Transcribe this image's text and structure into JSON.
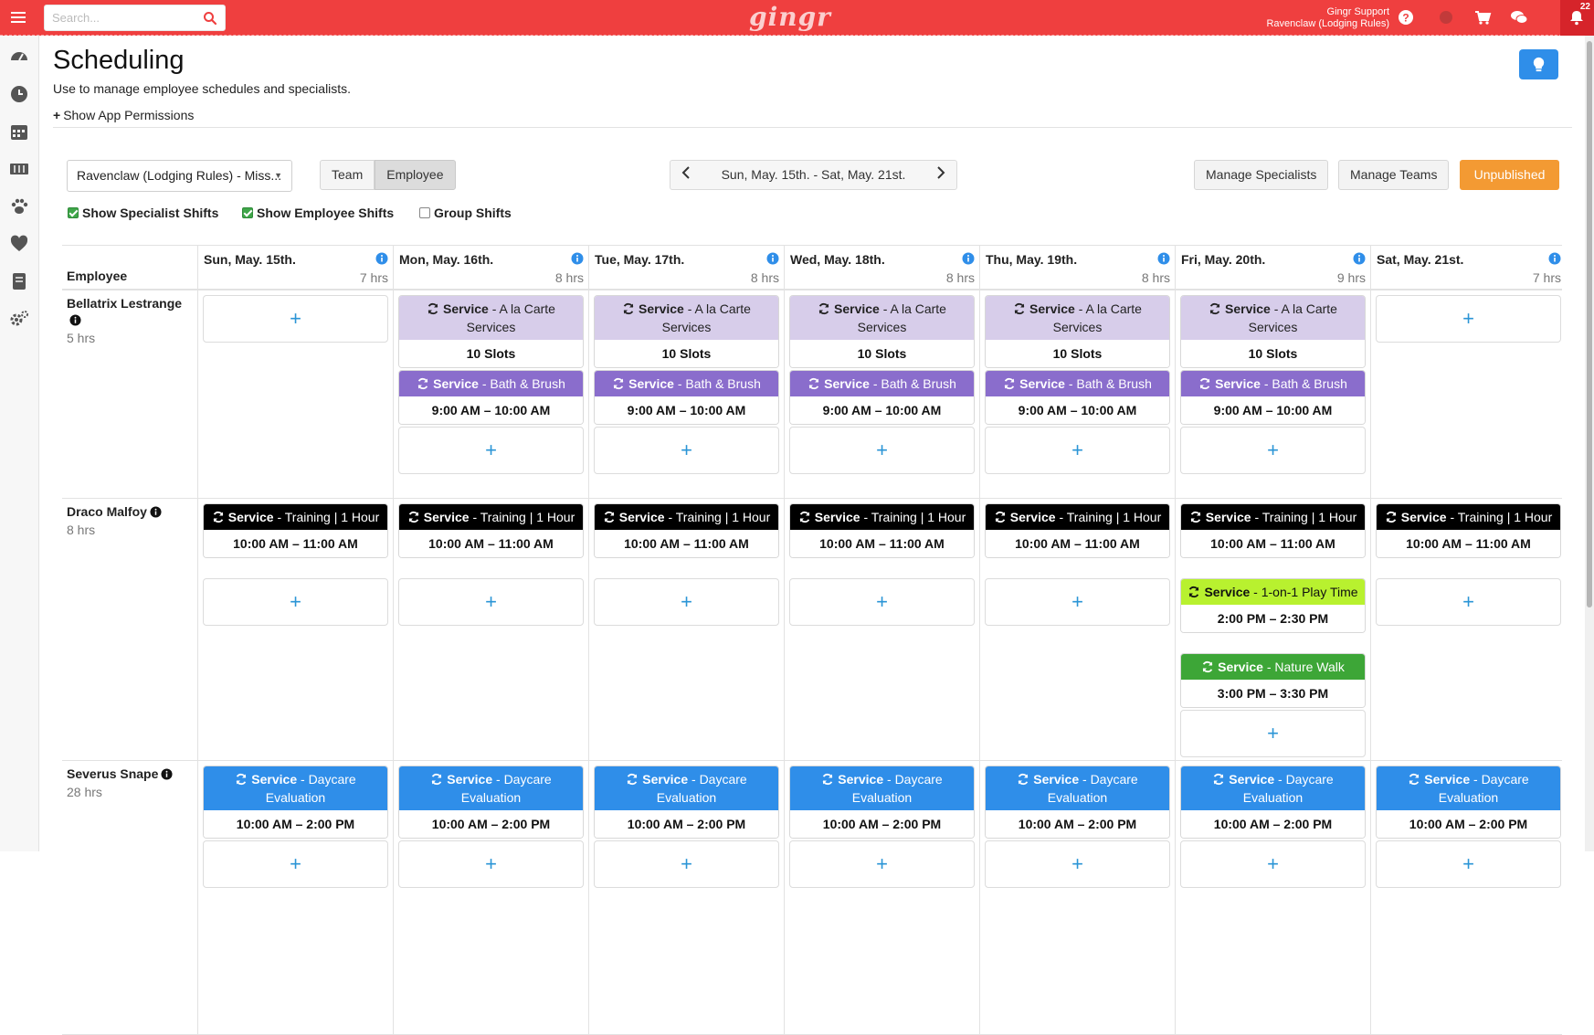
{
  "topbar": {
    "search_placeholder": "Search...",
    "logo": "gingr",
    "user_name": "Gingr Support",
    "user_location": "Ravenclaw (Lodging Rules)",
    "notification_count": "22",
    "brand_color": "#ef3f3f"
  },
  "sidebar": {
    "icons": [
      "dashboard-icon",
      "clock-icon",
      "calendar-icon",
      "ticket-icon",
      "paw-icon",
      "heart-icon",
      "book-icon",
      "settings-icon"
    ]
  },
  "page": {
    "title": "Scheduling",
    "subtitle": "Use to manage employee schedules and specialists.",
    "permissions_link": "Show App Permissions"
  },
  "controls": {
    "location": "Ravenclaw (Lodging Rules) - Miss...",
    "view_team": "Team",
    "view_employee": "Employee",
    "week_range": "Sun, May. 15th. - Sat, May. 21st.",
    "manage_specialists": "Manage Specialists",
    "manage_teams": "Manage Teams",
    "unpublished": "Unpublished",
    "show_specialist_shifts": "Show Specialist Shifts",
    "show_employee_shifts": "Show Employee Shifts",
    "group_shifts": "Group Shifts",
    "show_specialist_checked": true,
    "show_employee_checked": true,
    "group_checked": false
  },
  "grid": {
    "employee_header": "Employee",
    "days": [
      {
        "name": "Sun, May. 15th.",
        "hours": "7 hrs"
      },
      {
        "name": "Mon, May. 16th.",
        "hours": "8 hrs"
      },
      {
        "name": "Tue, May. 17th.",
        "hours": "8 hrs"
      },
      {
        "name": "Wed, May. 18th.",
        "hours": "8 hrs"
      },
      {
        "name": "Thu, May. 19th.",
        "hours": "8 hrs"
      },
      {
        "name": "Fri, May. 20th.",
        "hours": "9 hrs"
      },
      {
        "name": "Sat, May. 21st.",
        "hours": "7 hrs"
      }
    ],
    "employees": [
      {
        "name": "Bellatrix Lestrange",
        "hours": "5 hrs",
        "days": [
          [
            {
              "type": "add"
            }
          ],
          [
            {
              "type": "shift",
              "kind": "Service",
              "label": "A la Carte Services",
              "foot": "10 Slots",
              "color": "alacarte"
            },
            {
              "type": "shift",
              "kind": "Service",
              "label": "Bath & Brush",
              "foot": "9:00 AM – 10:00 AM",
              "color": "bath"
            },
            {
              "type": "add"
            }
          ],
          [
            {
              "type": "shift",
              "kind": "Service",
              "label": "A la Carte Services",
              "foot": "10 Slots",
              "color": "alacarte"
            },
            {
              "type": "shift",
              "kind": "Service",
              "label": "Bath & Brush",
              "foot": "9:00 AM – 10:00 AM",
              "color": "bath"
            },
            {
              "type": "add"
            }
          ],
          [
            {
              "type": "shift",
              "kind": "Service",
              "label": "A la Carte Services",
              "foot": "10 Slots",
              "color": "alacarte"
            },
            {
              "type": "shift",
              "kind": "Service",
              "label": "Bath & Brush",
              "foot": "9:00 AM – 10:00 AM",
              "color": "bath"
            },
            {
              "type": "add"
            }
          ],
          [
            {
              "type": "shift",
              "kind": "Service",
              "label": "A la Carte Services",
              "foot": "10 Slots",
              "color": "alacarte"
            },
            {
              "type": "shift",
              "kind": "Service",
              "label": "Bath & Brush",
              "foot": "9:00 AM – 10:00 AM",
              "color": "bath"
            },
            {
              "type": "add"
            }
          ],
          [
            {
              "type": "shift",
              "kind": "Service",
              "label": "A la Carte Services",
              "foot": "10 Slots",
              "color": "alacarte"
            },
            {
              "type": "shift",
              "kind": "Service",
              "label": "Bath & Brush",
              "foot": "9:00 AM – 10:00 AM",
              "color": "bath"
            },
            {
              "type": "add"
            }
          ],
          [
            {
              "type": "add"
            }
          ]
        ]
      },
      {
        "name": "Draco Malfoy",
        "hours": "8 hrs",
        "days": [
          [
            {
              "type": "shift",
              "kind": "Service",
              "label": "Training | 1 Hour",
              "foot": "10:00 AM – 11:00 AM",
              "color": "train"
            },
            {
              "type": "add"
            }
          ],
          [
            {
              "type": "shift",
              "kind": "Service",
              "label": "Training | 1 Hour",
              "foot": "10:00 AM – 11:00 AM",
              "color": "train"
            },
            {
              "type": "add"
            }
          ],
          [
            {
              "type": "shift",
              "kind": "Service",
              "label": "Training | 1 Hour",
              "foot": "10:00 AM – 11:00 AM",
              "color": "train"
            },
            {
              "type": "add"
            }
          ],
          [
            {
              "type": "shift",
              "kind": "Service",
              "label": "Training | 1 Hour",
              "foot": "10:00 AM – 11:00 AM",
              "color": "train"
            },
            {
              "type": "add"
            }
          ],
          [
            {
              "type": "shift",
              "kind": "Service",
              "label": "Training | 1 Hour",
              "foot": "10:00 AM – 11:00 AM",
              "color": "train"
            },
            {
              "type": "add"
            }
          ],
          [
            {
              "type": "shift",
              "kind": "Service",
              "label": "Training | 1 Hour",
              "foot": "10:00 AM – 11:00 AM",
              "color": "train"
            },
            {
              "type": "shift",
              "kind": "Service",
              "label": "1-on-1 Play Time",
              "foot": "2:00 PM – 2:30 PM",
              "color": "play"
            },
            {
              "type": "shift",
              "kind": "Service",
              "label": "Nature Walk",
              "foot": "3:00 PM – 3:30 PM",
              "color": "walk"
            },
            {
              "type": "add"
            }
          ],
          [
            {
              "type": "shift",
              "kind": "Service",
              "label": "Training | 1 Hour",
              "foot": "10:00 AM – 11:00 AM",
              "color": "train"
            },
            {
              "type": "add"
            }
          ]
        ]
      },
      {
        "name": "Severus Snape",
        "hours": "28 hrs",
        "days": [
          [
            {
              "type": "shift",
              "kind": "Service",
              "label": "Daycare Evaluation",
              "foot": "10:00 AM – 2:00 PM",
              "color": "day"
            },
            {
              "type": "add"
            }
          ],
          [
            {
              "type": "shift",
              "kind": "Service",
              "label": "Daycare Evaluation",
              "foot": "10:00 AM – 2:00 PM",
              "color": "day"
            },
            {
              "type": "add"
            }
          ],
          [
            {
              "type": "shift",
              "kind": "Service",
              "label": "Daycare Evaluation",
              "foot": "10:00 AM – 2:00 PM",
              "color": "day"
            },
            {
              "type": "add"
            }
          ],
          [
            {
              "type": "shift",
              "kind": "Service",
              "label": "Daycare Evaluation",
              "foot": "10:00 AM – 2:00 PM",
              "color": "day"
            },
            {
              "type": "add"
            }
          ],
          [
            {
              "type": "shift",
              "kind": "Service",
              "label": "Daycare Evaluation",
              "foot": "10:00 AM – 2:00 PM",
              "color": "day"
            },
            {
              "type": "add"
            }
          ],
          [
            {
              "type": "shift",
              "kind": "Service",
              "label": "Daycare Evaluation",
              "foot": "10:00 AM – 2:00 PM",
              "color": "day"
            },
            {
              "type": "add"
            }
          ],
          [
            {
              "type": "shift",
              "kind": "Service",
              "label": "Daycare Evaluation",
              "foot": "10:00 AM – 2:00 PM",
              "color": "day"
            },
            {
              "type": "add"
            }
          ]
        ]
      }
    ]
  },
  "shift_colors": {
    "alacarte": "#d7cdea",
    "bath": "#8a6dcc",
    "train": "#000000",
    "play": "#b8f12f",
    "walk": "#3da637",
    "day": "#2f8ee9"
  }
}
